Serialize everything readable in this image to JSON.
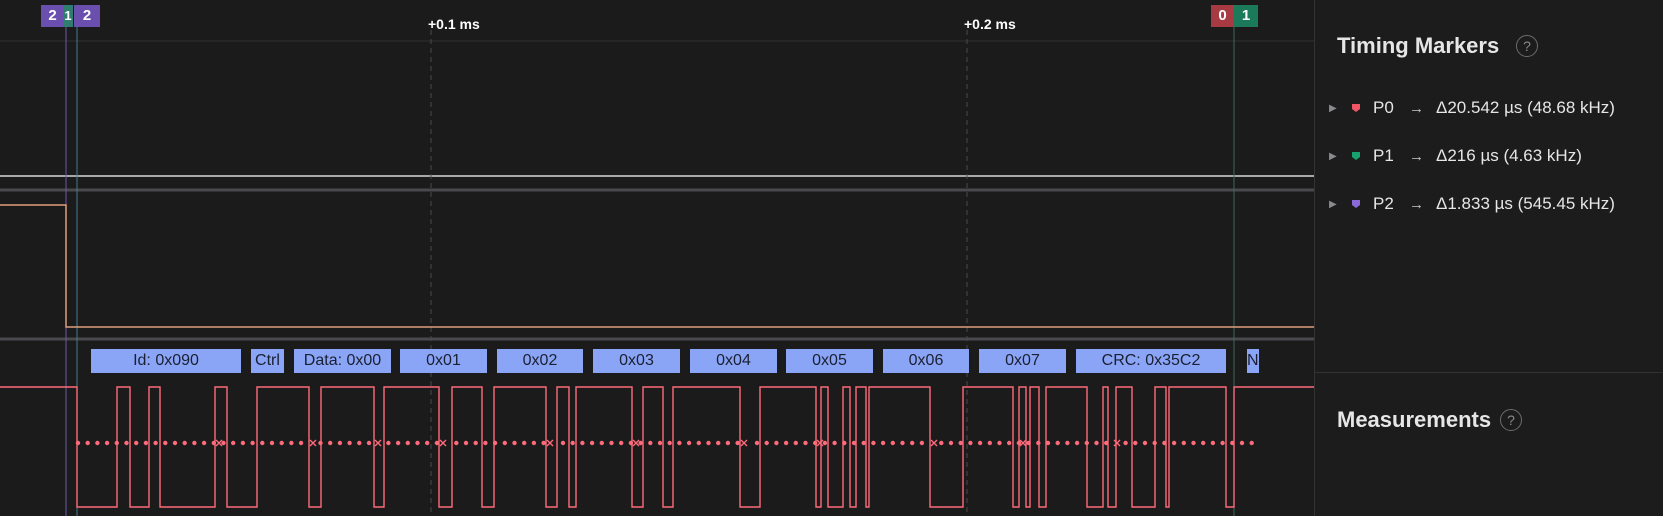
{
  "ruler": {
    "time_labels": [
      "+0.1 ms",
      "+0.2 ms"
    ],
    "left_markers": [
      "2",
      "1",
      "2"
    ],
    "right_markers": [
      "0",
      "1"
    ]
  },
  "colors": {
    "signal": "#ff6b7a",
    "packet_fill": "#8aa5f5",
    "p0": "#e05260",
    "p1": "#1a9e6e",
    "p2": "#7b5fc7"
  },
  "packets": [
    "Id: 0x090",
    "Ctrl",
    "Data: 0x00",
    "0x01",
    "0x02",
    "0x03",
    "0x04",
    "0x05",
    "0x06",
    "0x07",
    "CRC: 0x35C2",
    "N"
  ],
  "panel": {
    "timing_title": "Timing Markers",
    "help_glyph": "?",
    "markers": [
      {
        "name": "P0",
        "delta": "Δ20.542 µs (48.68 kHz)",
        "color": "#f05666",
        "icon": "flag-icon"
      },
      {
        "name": "P1",
        "delta": "Δ216 µs (4.63 kHz)",
        "color": "#18a070",
        "icon": "flag-icon"
      },
      {
        "name": "P2",
        "delta": "Δ1.833 µs (545.45 kHz)",
        "color": "#8a6ad8",
        "icon": "flag-icon"
      }
    ],
    "measurements_title": "Measurements"
  }
}
